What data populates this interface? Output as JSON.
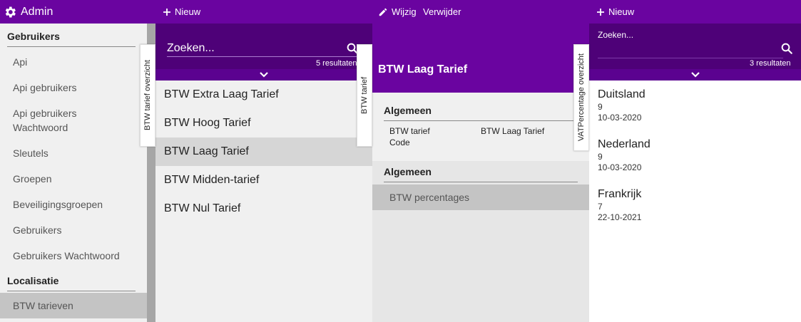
{
  "topbar": {
    "app_title": "Admin",
    "new_label_1": "Nieuw",
    "edit_label": "Wijzig",
    "delete_label": "Verwijder",
    "new_label_2": "Nieuw"
  },
  "sidebar": {
    "section_users": "Gebruikers",
    "items_users": [
      "Api",
      "Api gebruikers",
      "Api gebruikers Wachtwoord",
      "Sleutels",
      "Groepen",
      "Beveiligingsgroepen",
      "Gebruikers",
      "Gebruikers Wachtwoord"
    ],
    "section_localisation": "Localisatie",
    "items_localisation": [
      "BTW tarieven"
    ],
    "selected": "BTW tarieven"
  },
  "vertical_tabs": {
    "list_overview": "BTW tarief overzicht",
    "detail_tab": "BTW tarief",
    "vat_overview": "VATPercentage overzicht"
  },
  "list_panel": {
    "search_placeholder": "Zoeken...",
    "result_count": "5 resultaten",
    "items": [
      "BTW Extra Laag Tarief",
      "BTW Hoog Tarief",
      "BTW Laag Tarief",
      "BTW Midden-tarief",
      "BTW Nul Tarief"
    ],
    "selected": "BTW Laag Tarief"
  },
  "detail_panel": {
    "title": "BTW Laag Tarief",
    "section_1": "Algemeen",
    "field_label": "BTW tarief Code",
    "field_value": "BTW Laag Tarief",
    "section_2": "Algemeen",
    "link_label": "BTW percentages"
  },
  "right_panel": {
    "search_placeholder": "Zoeken...",
    "result_count": "3 resultaten",
    "items": [
      {
        "name": "Duitsland",
        "value": "9",
        "date": "10-03-2020"
      },
      {
        "name": "Nederland",
        "value": "9",
        "date": "10-03-2020"
      },
      {
        "name": "Frankrijk",
        "value": "7",
        "date": "22-10-2021"
      }
    ]
  },
  "colors": {
    "primary": "#6a04a0",
    "primary_dark": "#4e0178",
    "selected_row": "#d6d6d6",
    "sidebar_selected": "#c4c4c4"
  },
  "icons": [
    "gear-icon",
    "plus-icon",
    "pencil-icon",
    "search-icon",
    "chevron-down-icon"
  ]
}
